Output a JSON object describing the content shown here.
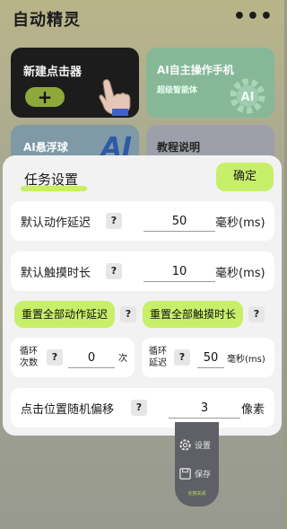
{
  "app": {
    "title": "自动精灵",
    "menu_icon": "more-dots-icon",
    "cards": {
      "new_clicker": {
        "title": "新建点击器",
        "plus": "+"
      },
      "ai_operator": {
        "title": "AI自主操作手机",
        "subtitle": "超级智能体",
        "badge": "AI"
      },
      "ai_float": {
        "title": "AI悬浮球",
        "logo": "AI"
      },
      "guide": {
        "title": "教程说明"
      }
    }
  },
  "dialog": {
    "title": "任务设置",
    "confirm_label": "确定",
    "help": "?",
    "default_delay": {
      "label": "默认动作延迟",
      "value": "50",
      "unit": "毫秒(ms)"
    },
    "default_touch": {
      "label": "默认触摸时长",
      "value": "10",
      "unit": "毫秒(ms)"
    },
    "reset_delay_label": "重置全部动作延迟",
    "reset_touch_label": "重置全部触摸时长",
    "loop_count": {
      "label_line1": "循环",
      "label_line2": "次数",
      "value": "0",
      "unit": "次"
    },
    "loop_delay": {
      "label_line1": "循环",
      "label_line2": "延迟",
      "value": "50",
      "unit": "毫秒(ms)"
    },
    "random_offset": {
      "label": "点击位置随机偏移",
      "value": "3",
      "unit": "像素"
    }
  },
  "float_bar": {
    "settings_label": "设置",
    "save_label": "保存",
    "hint": "长按关闭"
  },
  "colors": {
    "accent": "#c8ef6a",
    "dialog_bg": "#f2f2f2",
    "row_bg": "#ffffff",
    "float_bar_bg": "#5f6066"
  }
}
